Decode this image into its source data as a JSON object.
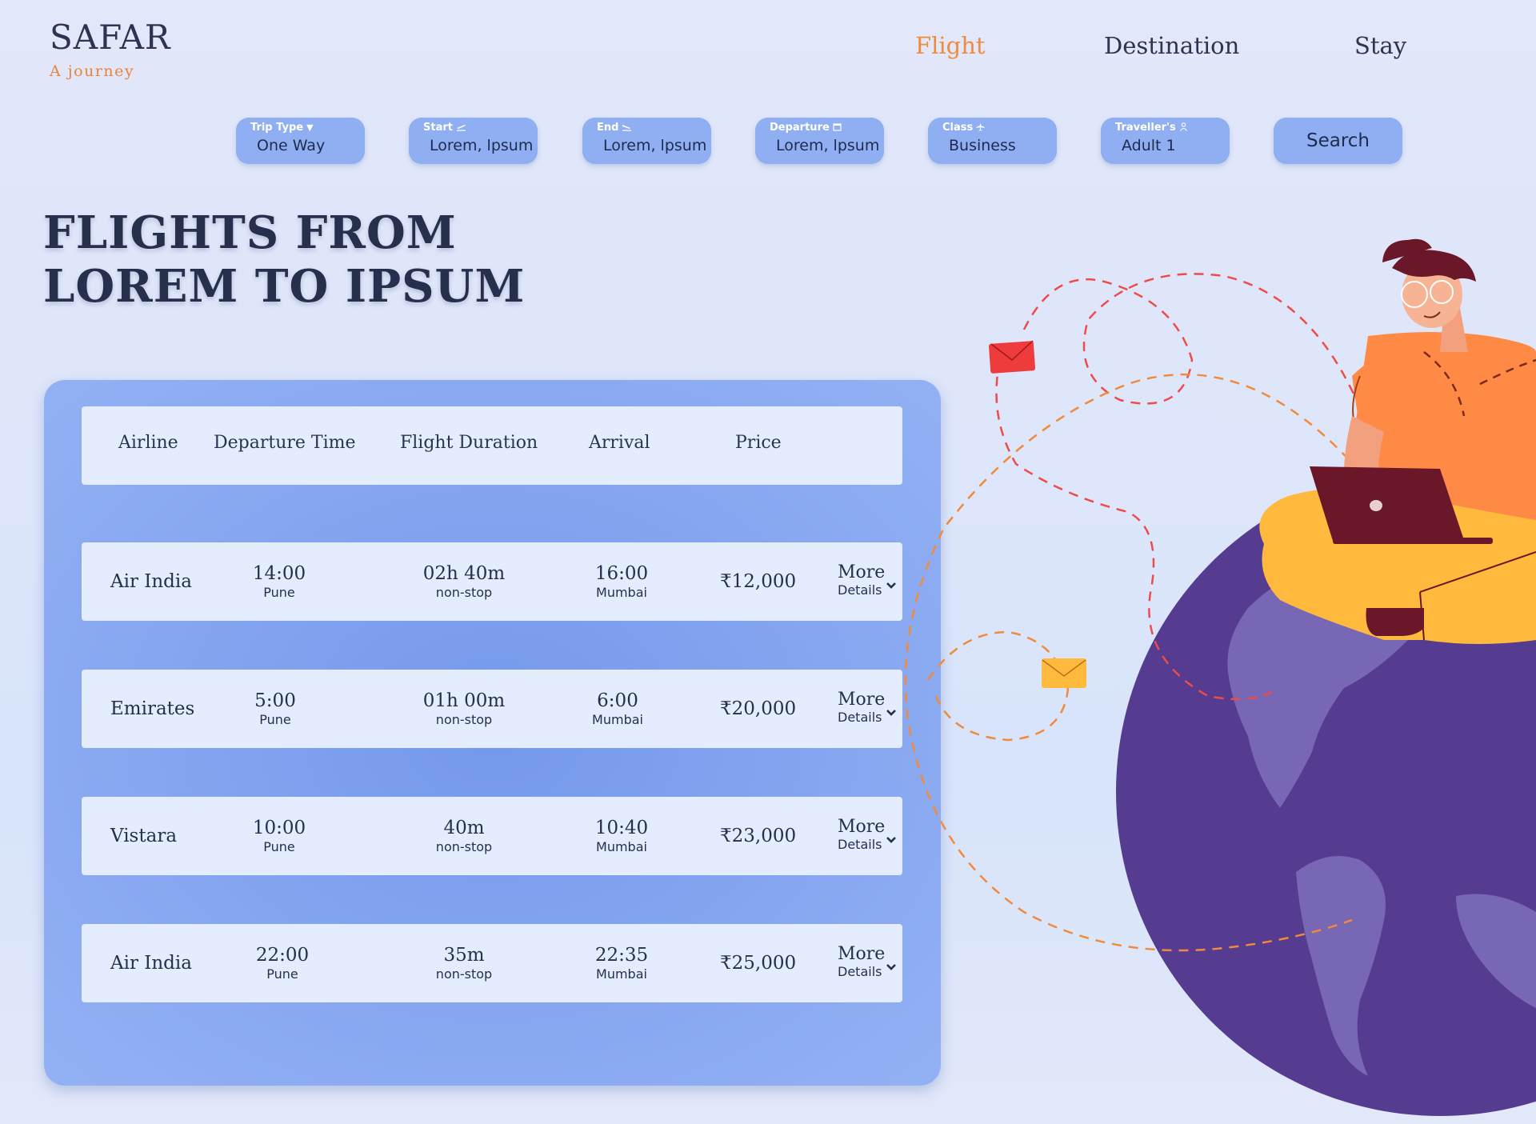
{
  "brand": {
    "title": "SAFAR",
    "tagline": "A journey"
  },
  "nav": [
    {
      "label": "Flight",
      "active": true
    },
    {
      "label": "Destination",
      "active": false
    },
    {
      "label": "Stay",
      "active": false
    }
  ],
  "search": {
    "fields": [
      {
        "label": "Trip Type",
        "icon": "caret-down-icon",
        "value": "One Way"
      },
      {
        "label": "Start",
        "icon": "plane-takeoff-icon",
        "value": "Lorem, lpsum"
      },
      {
        "label": "End",
        "icon": "plane-landing-icon",
        "value": "Lorem, lpsum"
      },
      {
        "label": "Departure",
        "icon": "calendar-icon",
        "value": "Lorem, lpsum"
      },
      {
        "label": "Class",
        "icon": "plane-icon",
        "value": "Business"
      },
      {
        "label": "Traveller's",
        "icon": "person-icon",
        "value": "Adult 1"
      }
    ],
    "button_label": "Search"
  },
  "heading": {
    "line1": "FLIGHTS FROM",
    "line2": "LOREM TO IPSUM"
  },
  "table": {
    "headers": [
      "Airline",
      "Departure Time",
      "Flight Duration",
      "Arrival",
      "Price"
    ],
    "rows": [
      {
        "airline": "Air India",
        "dep_time": "14:00",
        "dep_city": "Pune",
        "duration": "02h 40m",
        "stops": "non-stop",
        "arr_time": "16:00",
        "arr_city": "Mumbai",
        "price": "12,000",
        "more1": "More",
        "more2": "Details"
      },
      {
        "airline": "Emirates",
        "dep_time": "5:00",
        "dep_city": "Pune",
        "duration": "01h 00m",
        "stops": "non-stop",
        "arr_time": "6:00",
        "arr_city": "Mumbai",
        "price": "20,000",
        "more1": "More",
        "more2": "Details"
      },
      {
        "airline": "Vistara",
        "dep_time": "10:00",
        "dep_city": "Pune",
        "duration": "40m",
        "stops": "non-stop",
        "arr_time": "10:40",
        "arr_city": "Mumbai",
        "price": "23,000",
        "more1": "More",
        "more2": "Details"
      },
      {
        "airline": "Air India",
        "dep_time": "22:00",
        "dep_city": "Pune",
        "duration": "35m",
        "stops": "non-stop",
        "arr_time": "22:35",
        "arr_city": "Mumbai",
        "price": "25,000",
        "more1": "More",
        "more2": "Details"
      }
    ],
    "currency_symbol": "₹"
  },
  "colors": {
    "accent": "#f08a3c",
    "pill": "#90aff2",
    "panel": "#86a6f0",
    "row": "#e3edfd",
    "text": "#26304d",
    "globe": "#553c91",
    "continent": "#7867b4",
    "shirt": "#ff8a45",
    "pants": "#ffb93d",
    "laptop": "#6a1729"
  }
}
